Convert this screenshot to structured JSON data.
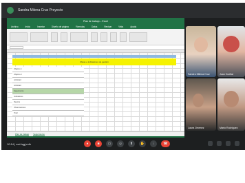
{
  "meeting": {
    "title": "Sandra Milena Cruz Proyecto"
  },
  "excel": {
    "window_title": "Plan de trabajo – Excel",
    "menu": [
      "Archivo",
      "Inicio",
      "Insertar",
      "Diseño de página",
      "Fórmulas",
      "Datos",
      "Revisar",
      "Vista",
      "Ayuda"
    ],
    "header_band": "Metas e indicadores de gestión",
    "rows": [
      "Objetivo 1",
      "Objetivo 2",
      "Actividad",
      "Actividad",
      "Seguimiento",
      "Indicadores",
      "Reporte",
      "Observaciones",
      "Total"
    ],
    "sheet_tabs": [
      "Plan de trabajo",
      "Seguimiento"
    ]
  },
  "participants": [
    {
      "name": "Sandra Milena Cruz"
    },
    {
      "name": "Juan Cuellar"
    },
    {
      "name": "Laura Jimenez"
    },
    {
      "name": "Mario Rodríguez"
    }
  ],
  "bottom_bar": {
    "time": "10:14",
    "meeting_code": "| vxd-iqgj-mih"
  }
}
